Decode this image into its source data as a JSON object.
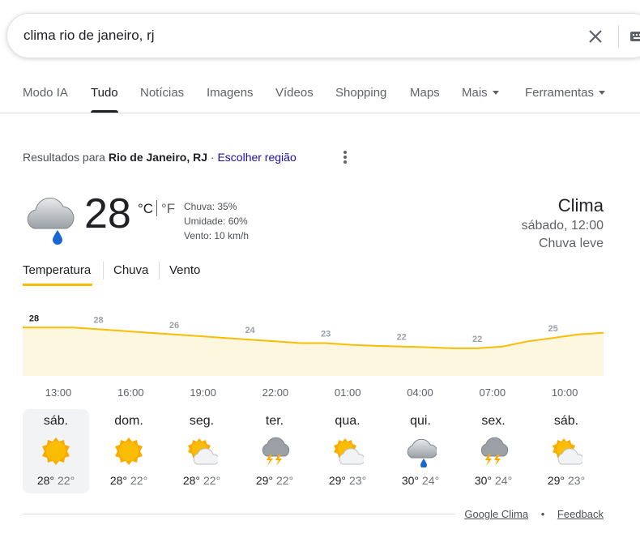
{
  "search": {
    "query": "clima rio de janeiro, rj"
  },
  "tabs": [
    "Modo IA",
    "Tudo",
    "Notícias",
    "Imagens",
    "Vídeos",
    "Shopping",
    "Maps",
    "Mais",
    "Ferramentas"
  ],
  "results_for": {
    "prefix": "Resultados para",
    "location": "Rio de Janeiro, RJ",
    "separator": "·",
    "change_region": "Escolher região"
  },
  "current": {
    "temperature": "28",
    "unit_c": "°C",
    "unit_f": "°F",
    "details": [
      "Chuva: 35%",
      "Umidade: 60%",
      "Vento: 10 km/h"
    ],
    "icon": "cloud-rain-icon"
  },
  "header": {
    "title": "Clima",
    "datetime": "sábado, 12:00",
    "condition": "Chuva leve"
  },
  "subtabs": [
    "Temperatura",
    "Chuva",
    "Vento"
  ],
  "chart_data": {
    "type": "area",
    "x": [
      "12:00",
      "13:00",
      "14:00",
      "15:00",
      "16:00",
      "17:00",
      "18:00",
      "19:00",
      "20:00",
      "21:00",
      "22:00",
      "23:00",
      "00:00",
      "01:00",
      "02:00",
      "03:00",
      "04:00",
      "05:00",
      "06:00",
      "07:00",
      "08:00",
      "09:00",
      "10:00",
      "11:00"
    ],
    "values": [
      28,
      28,
      28,
      27.5,
      27,
      26.5,
      26,
      25.5,
      25,
      24.5,
      24,
      23.5,
      23.5,
      23,
      22.7,
      22.5,
      22.3,
      22,
      22,
      22.5,
      24,
      25,
      26,
      26.5
    ],
    "value_labels": [
      {
        "x": "12:00",
        "label": "28"
      },
      {
        "x": "15:00",
        "label": "28"
      },
      {
        "x": "18:00",
        "label": "26"
      },
      {
        "x": "21:00",
        "label": "24"
      },
      {
        "x": "00:00",
        "label": "23"
      },
      {
        "x": "03:00",
        "label": "22"
      },
      {
        "x": "06:00",
        "label": "22"
      },
      {
        "x": "09:00",
        "label": "25"
      }
    ],
    "tick_labels": [
      "13:00",
      "16:00",
      "19:00",
      "22:00",
      "01:00",
      "04:00",
      "07:00",
      "10:00"
    ],
    "line_color": "#fbbc04",
    "fill_color": "#fef7e0"
  },
  "days": [
    {
      "name": "sáb.",
      "hi": "28°",
      "lo": "22°",
      "icon": "sun-icon",
      "selected": true
    },
    {
      "name": "dom.",
      "hi": "28°",
      "lo": "22°",
      "icon": "sun-icon",
      "selected": false
    },
    {
      "name": "seg.",
      "hi": "28°",
      "lo": "22°",
      "icon": "partly-cloudy-icon",
      "selected": false
    },
    {
      "name": "ter.",
      "hi": "29°",
      "lo": "22°",
      "icon": "thunderstorm-icon",
      "selected": false
    },
    {
      "name": "qua.",
      "hi": "29°",
      "lo": "23°",
      "icon": "partly-cloudy-icon",
      "selected": false
    },
    {
      "name": "qui.",
      "hi": "30°",
      "lo": "24°",
      "icon": "cloud-rain-icon",
      "selected": false
    },
    {
      "name": "sex.",
      "hi": "30°",
      "lo": "24°",
      "icon": "thunderstorm-icon",
      "selected": false
    },
    {
      "name": "sáb.",
      "hi": "29°",
      "lo": "23°",
      "icon": "partly-cloudy-icon",
      "selected": false
    }
  ],
  "footer": {
    "source": "Google Clima",
    "separator": "•",
    "feedback": "Feedback"
  }
}
